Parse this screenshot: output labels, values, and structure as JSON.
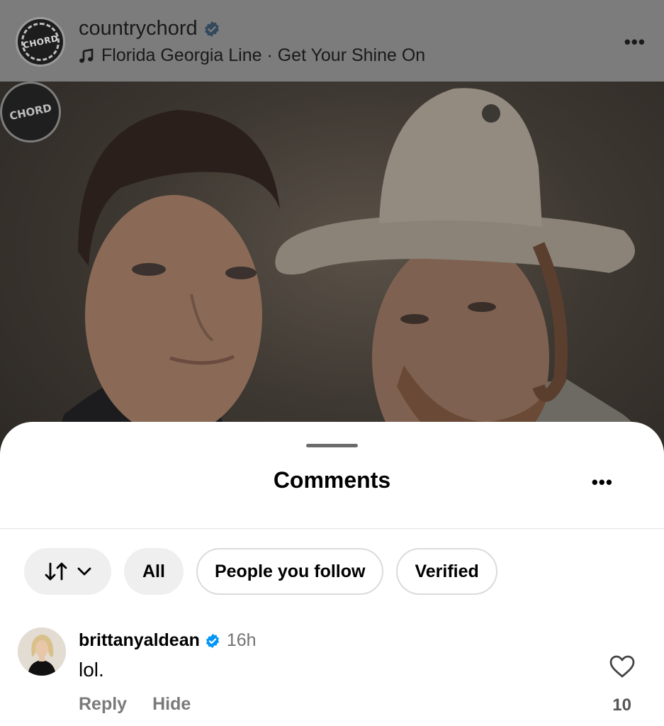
{
  "post": {
    "username": "countrychord",
    "logo_text": "CHORD",
    "music": "Florida Georgia Line · Get Your Shine On",
    "more": "•••"
  },
  "sheet": {
    "title": "Comments",
    "more": "•••",
    "filters": {
      "sort_icon": "sort-arrows-icon",
      "all": "All",
      "people_you_follow": "People you follow",
      "verified": "Verified"
    }
  },
  "comments": [
    {
      "username": "brittanyaldean",
      "time": "16h",
      "text": "lol.",
      "reply": "Reply",
      "hide": "Hide",
      "likes": "10"
    }
  ],
  "colors": {
    "verified_blue": "#0095f6",
    "dim_overlay": "#7c7c7c",
    "muted_text": "#737373"
  }
}
